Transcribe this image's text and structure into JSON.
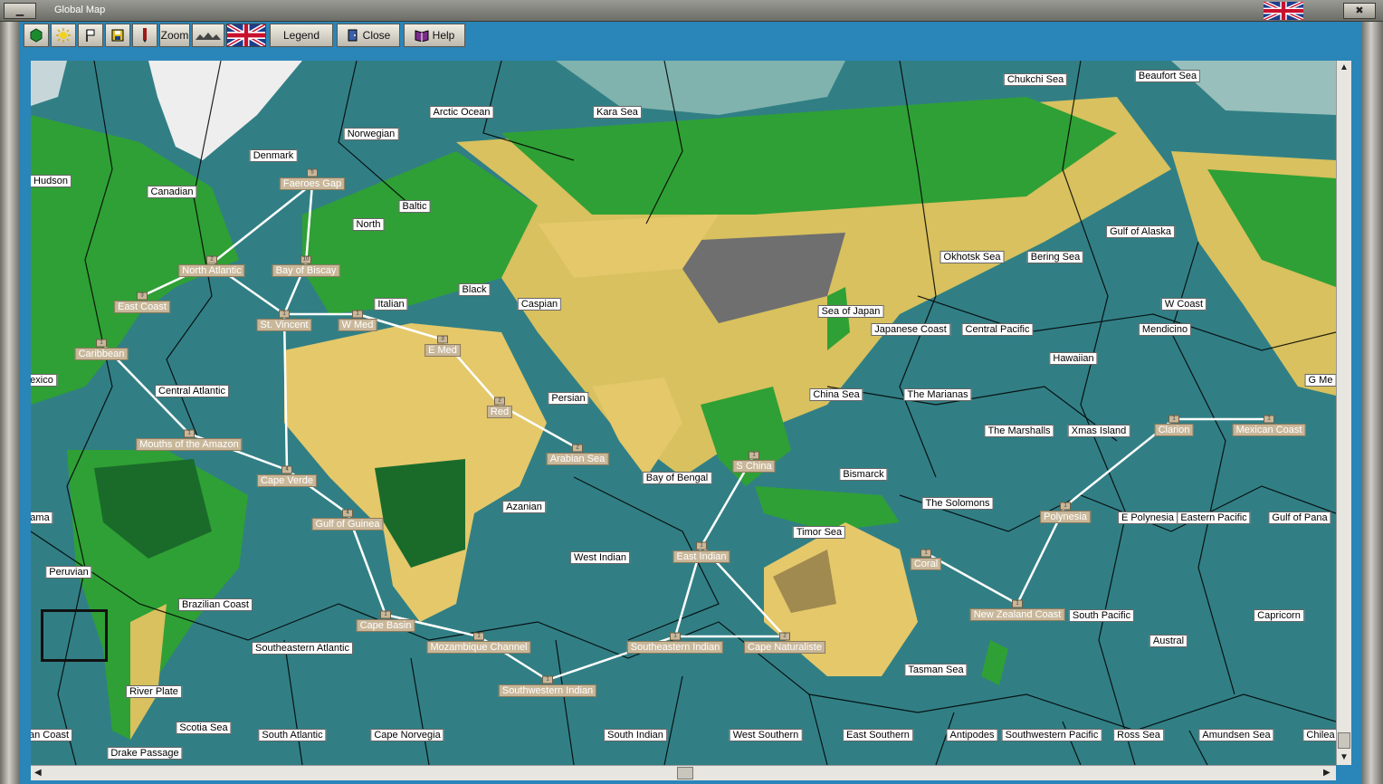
{
  "window": {
    "title": "Global Map",
    "min_glyph": "▁",
    "close_glyph": "✖"
  },
  "toolbar": {
    "zoom_label": "Zoom",
    "legend_label": "Legend",
    "close_label": "Close",
    "help_label": "Help",
    "icons": [
      "hexagon-icon",
      "sun-icon",
      "flag-icon",
      "save-icon",
      "pen-icon",
      "terrain-icon",
      "union-jack-flag"
    ]
  },
  "colors": {
    "sea": "#317f85",
    "land_desert": "#e4c86a",
    "land_green": "#2fa035",
    "land_forest": "#1a6b2a",
    "mountain": "#6f6f6f",
    "ice": "#f2f2f2",
    "toolbar": "#2a85b8"
  },
  "map": {
    "regions": [
      "Chukchi Sea",
      "Beaufort Sea",
      "Arctic Ocean",
      "Kara Sea",
      "Norwegian",
      "Denmark",
      "Hudson",
      "Canadian",
      "Baltic",
      "North",
      "Gulf of Alaska",
      "Okhotsk Sea",
      "Bering Sea",
      "W Coast",
      "Black",
      "Caspian",
      "Italian",
      "Sea of Japan",
      "Japanese Coast",
      "Central Pacific",
      "Mendicino",
      "Hawaiian",
      "exico",
      "Central Atlantic",
      "Persian",
      "China Sea",
      "The Marianas",
      "G Me",
      "The Marshalls",
      "Xmas Island",
      "Bay of Bengal",
      "Bismarck",
      "Azanian",
      "The Solomons",
      "ama",
      "E Polynesia",
      "Eastern Pacific",
      "Gulf of Pana",
      "West Indian",
      "Timor Sea",
      "Peruvian",
      "Brazilian Coast",
      "South Pacific",
      "Capricorn",
      "Southeastern Atlantic",
      "Austral",
      "Tasman Sea",
      "River Plate",
      "Scotia Sea",
      "an Coast",
      "South Atlantic",
      "Cape Norvegia",
      "South Indian",
      "West Southern",
      "East Southern",
      "Antipodes",
      "Southwestern Pacific",
      "Ross Sea",
      "Amundsen Sea",
      "Chilea",
      "Drake Passage"
    ],
    "ports": [
      {
        "name": "Faeroes Gap",
        "n": "5"
      },
      {
        "name": "North Atlantic",
        "n": "2"
      },
      {
        "name": "Bay of Biscay",
        "n": "10"
      },
      {
        "name": "East Coast",
        "n": "3"
      },
      {
        "name": "St. Vincent",
        "n": "1"
      },
      {
        "name": "W Med",
        "n": "1"
      },
      {
        "name": "Caribbean",
        "n": "1"
      },
      {
        "name": "E Med",
        "n": "3"
      },
      {
        "name": "Red",
        "n": "2"
      },
      {
        "name": "Arabian Sea",
        "n": "2"
      },
      {
        "name": "Mouths of the Amazon",
        "n": "1"
      },
      {
        "name": "Cape Verde",
        "n": "4"
      },
      {
        "name": "S China",
        "n": "1"
      },
      {
        "name": "Gulf of Guinea",
        "n": "4"
      },
      {
        "name": "Clarion",
        "n": "1"
      },
      {
        "name": "Mexican Coast",
        "n": "1"
      },
      {
        "name": "Polynesia",
        "n": "1"
      },
      {
        "name": "East Indian",
        "n": "1"
      },
      {
        "name": "Coral",
        "n": "1"
      },
      {
        "name": "New Zealand Coast",
        "n": "1"
      },
      {
        "name": "Cape Basin",
        "n": "1"
      },
      {
        "name": "Mozambique Channel",
        "n": "1"
      },
      {
        "name": "Southeastern Indian",
        "n": "1"
      },
      {
        "name": "Cape Naturaliste",
        "n": "2"
      },
      {
        "name": "Southwestern Indian",
        "n": "1"
      }
    ]
  }
}
